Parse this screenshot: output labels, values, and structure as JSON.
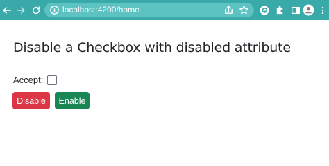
{
  "browser": {
    "url": "localhost:4200/home"
  },
  "page": {
    "title": "Disable a Checkbox with disabled attribute",
    "checkbox_label": "Accept:",
    "checkbox_checked": false,
    "buttons": {
      "disable_label": "Disable",
      "enable_label": "Enable"
    }
  },
  "colors": {
    "toolbar": "#3aa9aa",
    "omnibox": "#5cc2c2",
    "disable_button": "#dc3545",
    "enable_button": "#198754"
  },
  "icons": [
    "back-arrow-icon",
    "forward-arrow-icon",
    "reload-icon",
    "info-icon",
    "share-icon",
    "star-icon",
    "grammarly-icon",
    "puzzle-icon",
    "side-panel-icon",
    "avatar-icon",
    "menu-icon"
  ]
}
